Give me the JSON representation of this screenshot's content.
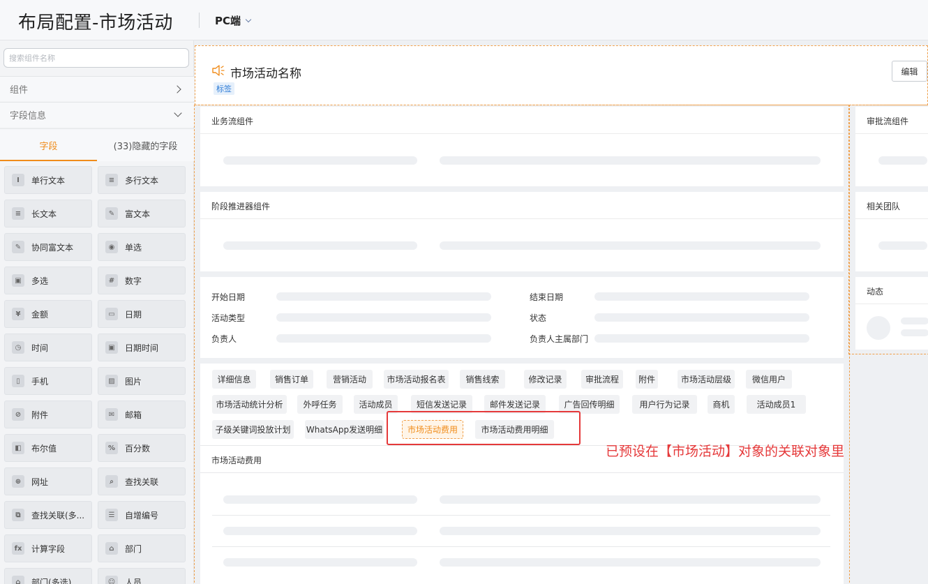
{
  "header": {
    "title": "布局配置-市场活动",
    "platform": "PC端"
  },
  "sidebar": {
    "search_placeholder": "搜索组件名称",
    "components_label": "组件",
    "field_info_label": "字段信息",
    "tabs": [
      "字段",
      "(33)隐藏的字段"
    ],
    "fields": [
      {
        "label": "单行文本",
        "icon": "I"
      },
      {
        "label": "多行文本",
        "icon": "≡"
      },
      {
        "label": "长文本",
        "icon": "≡"
      },
      {
        "label": "富文本",
        "icon": "✎"
      },
      {
        "label": "协同富文本",
        "icon": "✎"
      },
      {
        "label": "单选",
        "icon": "◉"
      },
      {
        "label": "多选",
        "icon": "▣"
      },
      {
        "label": "数字",
        "icon": "#"
      },
      {
        "label": "金额",
        "icon": "¥"
      },
      {
        "label": "日期",
        "icon": "▭"
      },
      {
        "label": "时间",
        "icon": "◷"
      },
      {
        "label": "日期时间",
        "icon": "▣"
      },
      {
        "label": "手机",
        "icon": "▯"
      },
      {
        "label": "图片",
        "icon": "▨"
      },
      {
        "label": "附件",
        "icon": "⊘"
      },
      {
        "label": "邮箱",
        "icon": "✉"
      },
      {
        "label": "布尔值",
        "icon": "◧"
      },
      {
        "label": "百分数",
        "icon": "%"
      },
      {
        "label": "网址",
        "icon": "⊕"
      },
      {
        "label": "查找关联",
        "icon": "⌕"
      },
      {
        "label": "查找关联(多...",
        "icon": "⧉"
      },
      {
        "label": "自增编号",
        "icon": "☰"
      },
      {
        "label": "计算字段",
        "icon": "fx"
      },
      {
        "label": "部门",
        "icon": "⌂"
      },
      {
        "label": "部门(多选)",
        "icon": "⌂"
      },
      {
        "label": "人员",
        "icon": "☺"
      }
    ]
  },
  "canvas": {
    "activity_name": "市场活动名称",
    "tag": "标签",
    "edit_label": "编辑",
    "cards": {
      "business_flow": "业务流组件",
      "stage_advancer": "阶段推进器组件",
      "approval_flow": "审批流组件",
      "related_team": "相关团队",
      "dynamics": "动态"
    },
    "info_fields": [
      "开始日期",
      "结束日期",
      "活动类型",
      "状态",
      "负责人",
      "负责人主属部门"
    ],
    "related_tabs": [
      "详细信息",
      "销售订单",
      "营销活动",
      "市场活动报名表",
      "销售线索",
      "修改记录",
      "审批流程",
      "附件",
      "市场活动层级",
      "微信用户",
      "市场活动统计分析",
      "外呼任务",
      "活动成员",
      "短信发送记录",
      "邮件发送记录",
      "广告回传明细",
      "用户行为记录",
      "商机",
      "活动成员1",
      "子级关键词投放计划",
      "WhatsApp发送明细",
      "市场活动费用",
      "市场活动费用明细"
    ],
    "selected_tab": "市场活动费用",
    "detail_title": "市场活动费用"
  },
  "annotation": "已预设在【市场活动】对象的关联对象里",
  "colors": {
    "accent": "#f08c1a",
    "annotation": "#e5393a",
    "tag": "#2d7bd6"
  }
}
